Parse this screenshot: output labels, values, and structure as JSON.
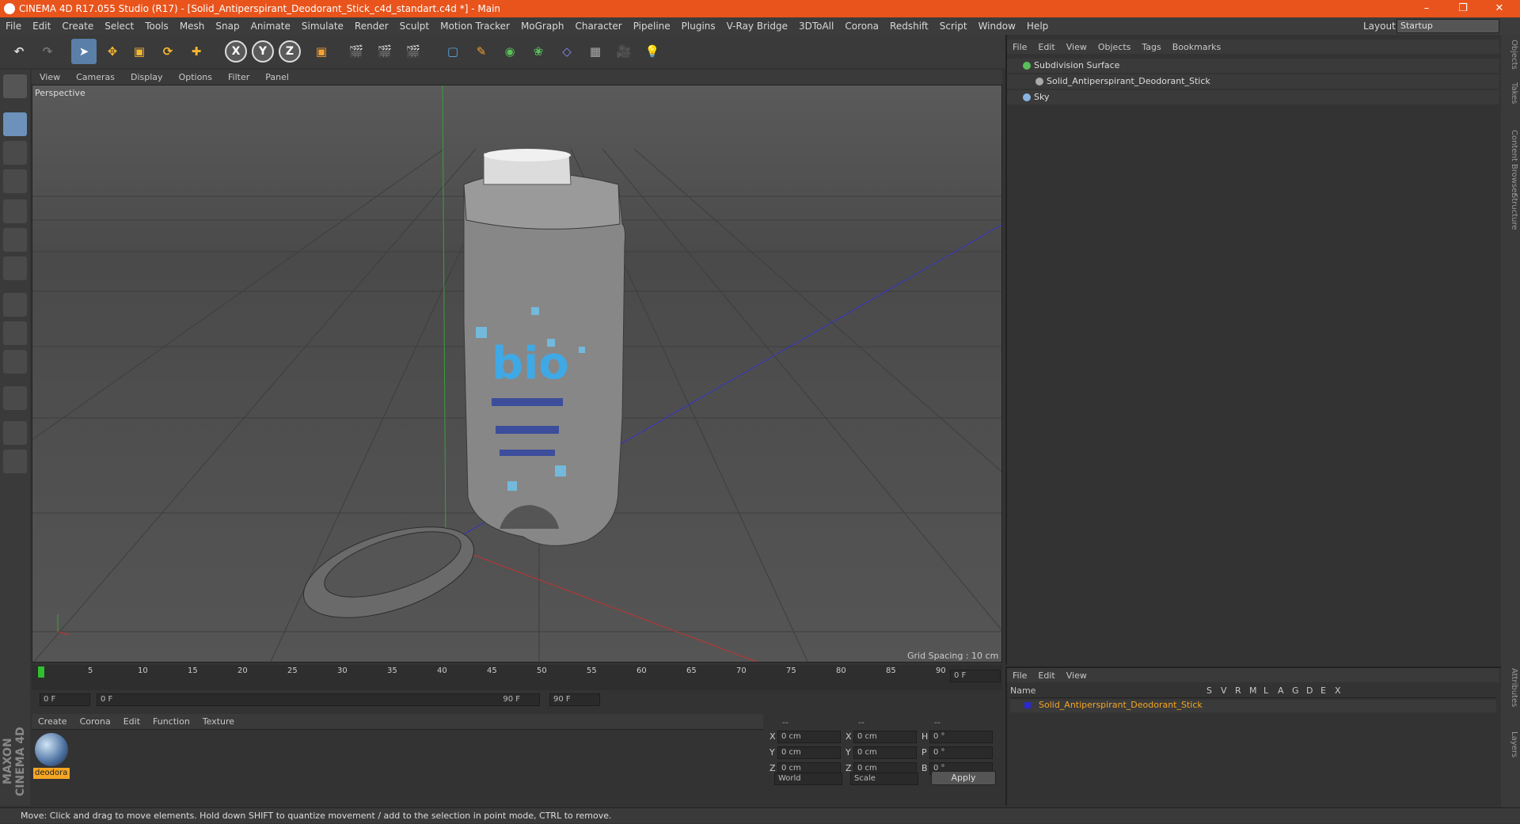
{
  "title": "CINEMA 4D R17.055 Studio (R17) - [Solid_Antiperspirant_Deodorant_Stick_c4d_standart.c4d *] - Main",
  "menu": [
    "File",
    "Edit",
    "Create",
    "Select",
    "Tools",
    "Mesh",
    "Snap",
    "Animate",
    "Simulate",
    "Render",
    "Sculpt",
    "Motion Tracker",
    "MoGraph",
    "Character",
    "Pipeline",
    "Plugins",
    "V-Ray Bridge",
    "3DToAll",
    "Corona",
    "Redshift",
    "Script",
    "Window",
    "Help"
  ],
  "layout": {
    "label": "Layout:",
    "value": "Startup"
  },
  "viewport_menu": [
    "View",
    "Cameras",
    "Display",
    "Options",
    "Filter",
    "Panel"
  ],
  "viewport": {
    "label": "Perspective",
    "grid_spacing": "Grid Spacing : 10 cm"
  },
  "timeline": {
    "ticks": [
      "0",
      "5",
      "10",
      "15",
      "20",
      "25",
      "30",
      "35",
      "40",
      "45",
      "50",
      "55",
      "60",
      "65",
      "70",
      "75",
      "80",
      "85",
      "90"
    ],
    "current": "0 F",
    "start": "0 F",
    "range_start": "0 F",
    "range_end": "90 F",
    "end": "90 F"
  },
  "material_menu": [
    "Create",
    "Corona",
    "Edit",
    "Function",
    "Texture"
  ],
  "material": {
    "name": "deodora"
  },
  "coords": {
    "headers": [
      "--",
      "--",
      "--"
    ],
    "rows": [
      {
        "a": "X",
        "av": "0 cm",
        "b": "X",
        "bv": "0 cm",
        "c": "H",
        "cv": "0 °"
      },
      {
        "a": "Y",
        "av": "0 cm",
        "b": "Y",
        "bv": "0 cm",
        "c": "P",
        "cv": "0 °"
      },
      {
        "a": "Z",
        "av": "0 cm",
        "b": "Z",
        "bv": "0 cm",
        "c": "B",
        "cv": "0 °"
      }
    ],
    "world": "World",
    "scale": "Scale",
    "apply": "Apply"
  },
  "objects_menu": [
    "File",
    "Edit",
    "View",
    "Objects",
    "Tags",
    "Bookmarks"
  ],
  "objects": [
    {
      "name": "Subdivision Surface",
      "color": "#5abf5a"
    },
    {
      "name": "Solid_Antiperspirant_Deodorant_Stick",
      "color": "#aaa"
    },
    {
      "name": "Sky",
      "color": "#8ab4e0"
    }
  ],
  "layers_menu": [
    "File",
    "Edit",
    "View"
  ],
  "layers": {
    "col_name": "Name",
    "cols": [
      "S",
      "V",
      "R",
      "M",
      "L",
      "A",
      "G",
      "D",
      "E",
      "X"
    ],
    "item": "Solid_Antiperspirant_Deodorant_Stick"
  },
  "right_tabs": [
    "Objects",
    "Takes",
    "Content Browser",
    "Structure",
    "Attributes",
    "Layers"
  ],
  "status": "Move: Click and drag to move elements. Hold down SHIFT to quantize movement / add to the selection in point mode, CTRL to remove.",
  "brand": "MAXON CINEMA 4D"
}
